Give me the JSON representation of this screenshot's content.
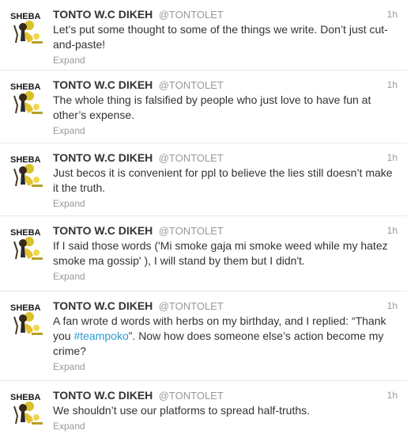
{
  "tweets": [
    {
      "name": "TONTO W.C DIKEH",
      "handle": "@TONTOLET",
      "time": "1h",
      "text_before": "Let’s put some thought to some of the things we write. Don’t just cut-and-paste!",
      "hashtag": "",
      "text_after": "",
      "expand": "Expand"
    },
    {
      "name": "TONTO W.C DIKEH",
      "handle": "@TONTOLET",
      "time": "1h",
      "text_before": "The whole thing is falsified by people who just love to have fun at other’s expense.",
      "hashtag": "",
      "text_after": "",
      "expand": "Expand"
    },
    {
      "name": "TONTO W.C DIKEH",
      "handle": "@TONTOLET",
      "time": "1h",
      "text_before": "Just becos it is convenient for ppl to believe the lies still doesn’t make it the truth.",
      "hashtag": "",
      "text_after": "",
      "expand": "Expand"
    },
    {
      "name": "TONTO W.C DIKEH",
      "handle": "@TONTOLET",
      "time": "1h",
      "text_before": "If I said those words ('Mi smoke gaja mi smoke weed while my hatez smoke ma gossip' ), I will stand by them but I didn't.",
      "hashtag": "",
      "text_after": "",
      "expand": "Expand"
    },
    {
      "name": "TONTO W.C DIKEH",
      "handle": "@TONTOLET",
      "time": "1h",
      "text_before": "A fan wrote d words with herbs on my birthday, and I replied: “Thank you ",
      "hashtag": "#teampoko",
      "text_after": "”. Now how does someone else’s action become my crime?",
      "expand": "Expand"
    },
    {
      "name": "TONTO W.C DIKEH",
      "handle": "@TONTOLET",
      "time": "1h",
      "text_before": "We shouldn’t use our platforms to spread half-truths.",
      "hashtag": "",
      "text_after": "",
      "expand": "Expand"
    }
  ],
  "avatar_logo_text": "SHEBA",
  "colors": {
    "hashtag": "#2a9ccf",
    "muted": "#999999",
    "text": "#333333",
    "divider": "#e8e8e8"
  }
}
